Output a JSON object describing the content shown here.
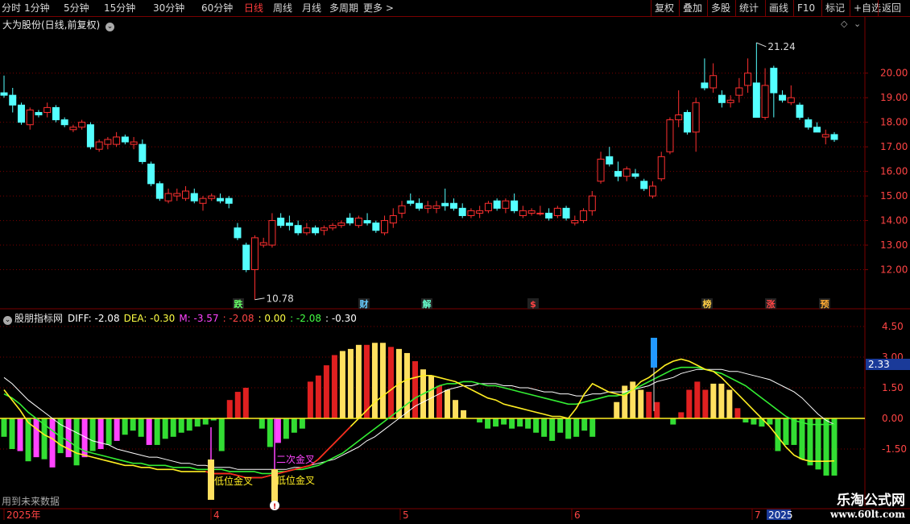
{
  "toolbar": {
    "left": [
      "分时",
      "1分钟",
      "5分钟",
      "15分钟",
      "30分钟",
      "60分钟",
      "日线",
      "周线",
      "月线",
      "多周期",
      "更多 >"
    ],
    "active": "日线",
    "right": [
      "复权",
      "叠加",
      "多股",
      "统计",
      "画线",
      "F10",
      "标记",
      "+自选",
      "返回"
    ]
  },
  "main_title": "大为股份(日线,前复权)",
  "price_axis": {
    "labels": [
      "20.00",
      "19.00",
      "18.00",
      "17.00",
      "16.00",
      "15.00",
      "14.00",
      "13.00",
      "12.00"
    ]
  },
  "annotations": {
    "high": "21.24",
    "low": "10.78"
  },
  "events": [
    {
      "label": "跌",
      "color": "#66ff66"
    },
    {
      "label": "财",
      "color": "#66ccff"
    },
    {
      "label": "解",
      "color": "#66ffcc"
    },
    {
      "label": "$",
      "color": "#ff4444"
    },
    {
      "label": "榜",
      "color": "#ffcc44"
    },
    {
      "label": "涨",
      "color": "#ff4444"
    },
    {
      "label": "预",
      "color": "#ffaa33"
    }
  ],
  "indicator": {
    "name": "股朋指标网",
    "items": [
      {
        "label": "DIFF: -2.08",
        "color": "#ffffff"
      },
      {
        "label": "DEA: -0.30",
        "color": "#ffff44"
      },
      {
        "label": "M: -3.57",
        "color": "#ff44ff"
      },
      {
        "label": ": -2.08",
        "color": "#ff4444"
      },
      {
        "label": ": 0.00",
        "color": "#ffff44"
      },
      {
        "label": ": -2.08",
        "color": "#44ff44"
      },
      {
        "label": ": -0.30",
        "color": "#ffffff"
      }
    ],
    "axis_labels": [
      "4.50",
      "3.00",
      "1.50",
      "0.00",
      "-1.50"
    ],
    "current_value": "2.33",
    "labels": {
      "cross1": "低位金叉",
      "cross2": "低位金叉",
      "cross3": "二次金叉"
    }
  },
  "footer_note": "用到未来数据",
  "date_axis": {
    "labels": [
      "2025年",
      "4",
      "5",
      "6",
      "7"
    ],
    "current": "2025"
  },
  "watermark": {
    "line1": "乐淘公式网",
    "line2": "www.60lt.com"
  },
  "colors": {
    "up": "#ff3030",
    "down": "#54ffff",
    "grid": "#7a0000",
    "axis_text": "#ff4444"
  },
  "chart_data": {
    "type": "candlestick",
    "candles": [
      [
        19.2,
        19.9,
        19.0,
        19.1
      ],
      [
        19.1,
        19.4,
        18.4,
        18.7
      ],
      [
        18.7,
        18.8,
        17.9,
        18.0
      ],
      [
        17.9,
        18.6,
        17.7,
        18.5
      ],
      [
        18.4,
        18.5,
        18.2,
        18.3
      ],
      [
        18.4,
        18.8,
        18.2,
        18.6
      ],
      [
        18.6,
        18.7,
        18.0,
        18.1
      ],
      [
        18.1,
        18.2,
        17.8,
        17.9
      ],
      [
        17.7,
        17.9,
        17.6,
        17.8
      ],
      [
        17.8,
        18.1,
        17.7,
        18.0
      ],
      [
        17.9,
        18.0,
        16.9,
        17.0
      ],
      [
        16.9,
        17.3,
        16.8,
        17.2
      ],
      [
        17.1,
        17.4,
        16.9,
        17.3
      ],
      [
        17.1,
        17.6,
        17.0,
        17.4
      ],
      [
        17.4,
        17.5,
        17.1,
        17.2
      ],
      [
        17.1,
        17.4,
        16.9,
        17.2
      ],
      [
        17.1,
        17.3,
        16.3,
        16.4
      ],
      [
        16.3,
        16.4,
        15.4,
        15.5
      ],
      [
        15.5,
        15.6,
        14.8,
        14.9
      ],
      [
        14.8,
        15.3,
        14.7,
        15.1
      ],
      [
        15.0,
        15.3,
        14.8,
        15.1
      ],
      [
        14.9,
        15.4,
        14.8,
        15.2
      ],
      [
        15.1,
        15.3,
        14.7,
        14.8
      ],
      [
        14.7,
        15.0,
        14.4,
        14.9
      ],
      [
        14.9,
        15.1,
        14.8,
        15.0
      ],
      [
        14.9,
        15.1,
        14.7,
        14.8
      ],
      [
        14.9,
        15.0,
        14.5,
        14.7
      ],
      [
        13.7,
        13.9,
        13.2,
        13.3
      ],
      [
        13.0,
        13.1,
        11.9,
        12.0
      ],
      [
        12.0,
        13.4,
        10.78,
        13.3
      ],
      [
        13.0,
        13.3,
        12.9,
        13.1
      ],
      [
        13.0,
        14.3,
        12.9,
        14.0
      ],
      [
        14.1,
        14.3,
        13.7,
        13.8
      ],
      [
        13.9,
        14.2,
        13.6,
        13.8
      ],
      [
        13.8,
        14.0,
        13.4,
        13.5
      ],
      [
        13.5,
        13.9,
        13.4,
        13.7
      ],
      [
        13.7,
        13.8,
        13.4,
        13.5
      ],
      [
        13.6,
        13.8,
        13.4,
        13.7
      ],
      [
        13.7,
        13.9,
        13.6,
        13.8
      ],
      [
        13.8,
        14.0,
        13.7,
        13.9
      ],
      [
        14.1,
        14.3,
        13.8,
        13.9
      ],
      [
        13.8,
        14.2,
        13.7,
        14.1
      ],
      [
        14.0,
        14.3,
        13.8,
        13.9
      ],
      [
        13.9,
        14.0,
        13.5,
        13.6
      ],
      [
        13.5,
        14.2,
        13.4,
        14.0
      ],
      [
        13.9,
        14.5,
        13.7,
        14.2
      ],
      [
        14.3,
        14.8,
        14.1,
        14.6
      ],
      [
        14.8,
        15.1,
        14.6,
        14.7
      ],
      [
        14.7,
        14.9,
        14.4,
        14.5
      ],
      [
        14.5,
        14.8,
        14.3,
        14.6
      ],
      [
        14.5,
        14.8,
        14.3,
        14.6
      ],
      [
        14.7,
        15.3,
        14.4,
        14.6
      ],
      [
        14.7,
        14.9,
        14.4,
        14.5
      ],
      [
        14.5,
        14.7,
        14.1,
        14.2
      ],
      [
        14.2,
        14.5,
        14.1,
        14.4
      ],
      [
        14.3,
        14.6,
        14.1,
        14.4
      ],
      [
        14.4,
        14.8,
        14.3,
        14.7
      ],
      [
        14.8,
        14.9,
        14.4,
        14.5
      ],
      [
        14.5,
        14.9,
        14.3,
        14.8
      ],
      [
        14.8,
        15.1,
        14.3,
        14.4
      ],
      [
        14.2,
        14.6,
        14.1,
        14.4
      ],
      [
        14.3,
        14.5,
        14.2,
        14.4
      ],
      [
        14.3,
        14.6,
        14.2,
        14.3
      ],
      [
        14.3,
        14.5,
        14.0,
        14.1
      ],
      [
        14.2,
        14.6,
        14.1,
        14.5
      ],
      [
        14.5,
        14.6,
        14.0,
        14.1
      ],
      [
        13.9,
        14.2,
        13.8,
        14.0
      ],
      [
        14.0,
        14.5,
        13.9,
        14.4
      ],
      [
        14.4,
        15.2,
        14.2,
        15.0
      ],
      [
        15.6,
        16.8,
        15.5,
        16.5
      ],
      [
        16.6,
        17.0,
        16.2,
        16.3
      ],
      [
        16.0,
        16.4,
        15.6,
        15.8
      ],
      [
        15.8,
        16.2,
        15.6,
        16.1
      ],
      [
        15.9,
        16.1,
        15.7,
        15.8
      ],
      [
        15.6,
        15.7,
        15.2,
        15.3
      ],
      [
        15.0,
        15.6,
        14.9,
        15.4
      ],
      [
        15.7,
        16.8,
        15.6,
        16.6
      ],
      [
        16.8,
        18.2,
        16.7,
        18.1
      ],
      [
        18.1,
        19.3,
        17.8,
        18.3
      ],
      [
        18.4,
        18.5,
        17.5,
        17.6
      ],
      [
        17.6,
        19.0,
        16.8,
        18.8
      ],
      [
        19.6,
        20.6,
        19.3,
        19.4
      ],
      [
        19.4,
        20.4,
        19.2,
        19.9
      ],
      [
        19.1,
        19.3,
        18.6,
        18.8
      ],
      [
        18.8,
        19.1,
        18.6,
        18.9
      ],
      [
        19.1,
        19.8,
        18.8,
        19.4
      ],
      [
        19.5,
        20.6,
        19.2,
        20.0
      ],
      [
        19.6,
        21.24,
        19.5,
        18.2
      ],
      [
        18.2,
        20.2,
        18.1,
        19.5
      ],
      [
        20.2,
        20.3,
        18.2,
        19.2
      ],
      [
        19.1,
        19.3,
        18.8,
        18.9
      ],
      [
        18.8,
        19.5,
        18.7,
        19.0
      ],
      [
        18.7,
        18.8,
        18.1,
        18.2
      ],
      [
        18.1,
        18.2,
        17.7,
        17.8
      ],
      [
        17.8,
        18.0,
        17.6,
        17.6
      ],
      [
        17.4,
        17.7,
        17.1,
        17.5
      ],
      [
        17.5,
        17.6,
        17.2,
        17.3
      ]
    ],
    "dates": {
      "start_label": "2025年",
      "month_labels": [
        "4",
        "5",
        "6",
        "7"
      ]
    },
    "ylim": [
      11.0,
      21.5
    ],
    "indicator": {
      "type": "bar+line",
      "ylim": [
        -2.6,
        5.3
      ],
      "hist": [
        -0.9,
        -1.5,
        -1.6,
        -2.1,
        -1.9,
        -2.0,
        -2.4,
        -1.7,
        -1.9,
        -2.3,
        -1.9,
        -1.6,
        -1.5,
        -1.3,
        -1.1,
        -0.8,
        -0.6,
        -0.9,
        -1.3,
        -1.3,
        -1.0,
        -0.9,
        -0.7,
        -0.6,
        -0.4,
        -0.3,
        -0.1,
        -1.6,
        0.9,
        1.3,
        1.5,
        0,
        -0.5,
        -1.4,
        -1.2,
        -1.0,
        -0.7,
        -0.5,
        1.8,
        2.1,
        2.6,
        3.1,
        3.3,
        3.4,
        3.6,
        3.6,
        3.7,
        3.7,
        3.5,
        3.4,
        3.2,
        2.8,
        2.4,
        2.1,
        1.6,
        1.4,
        0.9,
        0.4,
        0,
        -0.2,
        -0.5,
        -0.4,
        -0.3,
        -0.5,
        -0.4,
        -0.5,
        -0.7,
        -0.9,
        -1.1,
        -0.7,
        -1.0,
        -0.9,
        -0.6,
        -0.9,
        0,
        0,
        0.8,
        1.6,
        1.8,
        1.4,
        1.3,
        0.8,
        0,
        -0.3,
        0.3,
        1.4,
        1.8,
        1.4,
        1.7,
        1.7,
        1.4,
        0.5,
        -0.2,
        -0.3,
        -0.4,
        -0.3,
        -1.6,
        -1.3,
        -1.3,
        -2.0,
        -2.3,
        -2.5,
        -2.8,
        -2.8
      ],
      "diff": [
        1.4,
        0.9,
        0.4,
        -0.2,
        -0.5,
        -0.8,
        -1.0,
        -1.3,
        -1.5,
        -1.7,
        -1.8,
        -1.9,
        -2.0,
        -2.1,
        -2.2,
        -2.3,
        -2.3,
        -2.4,
        -2.4,
        -2.5,
        -2.5,
        -2.5,
        -2.6,
        -2.6,
        -2.6,
        -2.6,
        -2.7,
        -2.7,
        -2.7,
        -2.8,
        -2.9,
        -2.9,
        -2.9,
        -2.8,
        -2.7,
        -2.6,
        -2.5,
        -2.4,
        -2.3,
        -2.0,
        -1.6,
        -1.2,
        -0.8,
        -0.4,
        0.0,
        0.4,
        0.8,
        1.1,
        1.4,
        1.7,
        1.9,
        2.0,
        2.1,
        2.1,
        2.0,
        1.9,
        1.8,
        1.6,
        1.4,
        1.2,
        1.0,
        0.9,
        0.7,
        0.6,
        0.5,
        0.4,
        0.3,
        0.2,
        0.1,
        0.1,
        0.0,
        0.5,
        1.2,
        1.7,
        1.5,
        1.3,
        1.2,
        1.1,
        1.4,
        1.8,
        2.0,
        2.3,
        2.6,
        2.8,
        2.9,
        2.8,
        2.6,
        2.4,
        2.3,
        2.0,
        1.6,
        1.2,
        0.8,
        0.4,
        0.0,
        -0.4,
        -0.9,
        -1.4,
        -1.8,
        -2.0,
        -2.1,
        -2.1,
        -2.1,
        -2.08
      ],
      "dea": [
        1.2,
        1.0,
        0.7,
        0.3,
        0.0,
        -0.3,
        -0.6,
        -0.9,
        -1.1,
        -1.4,
        -1.6,
        -1.7,
        -1.8,
        -1.9,
        -2.0,
        -2.1,
        -2.2,
        -2.2,
        -2.3,
        -2.3,
        -2.3,
        -2.4,
        -2.4,
        -2.4,
        -2.5,
        -2.5,
        -2.5,
        -2.5,
        -2.6,
        -2.6,
        -2.6,
        -2.6,
        -2.7,
        -2.7,
        -2.6,
        -2.6,
        -2.5,
        -2.5,
        -2.4,
        -2.3,
        -2.1,
        -1.9,
        -1.7,
        -1.4,
        -1.1,
        -0.8,
        -0.5,
        -0.2,
        0.1,
        0.4,
        0.7,
        1.0,
        1.2,
        1.4,
        1.6,
        1.7,
        1.7,
        1.8,
        1.8,
        1.7,
        1.6,
        1.6,
        1.5,
        1.4,
        1.3,
        1.2,
        1.1,
        1.0,
        0.9,
        0.8,
        0.7,
        0.7,
        0.8,
        0.9,
        1.0,
        1.1,
        1.1,
        1.2,
        1.4,
        1.6,
        1.8,
        2.0,
        2.2,
        2.4,
        2.5,
        2.5,
        2.5,
        2.4,
        2.3,
        2.2,
        2.0,
        1.8,
        1.6,
        1.3,
        1.0,
        0.7,
        0.4,
        0.1,
        -0.1,
        -0.2,
        -0.3,
        -0.3,
        -0.3,
        -0.3
      ],
      "slow": [
        2.0,
        1.7,
        1.3,
        0.9,
        0.6,
        0.3,
        0.0,
        -0.3,
        -0.5,
        -0.7,
        -0.9,
        -1.1,
        -1.2,
        -1.3,
        -1.5,
        -1.6,
        -1.7,
        -1.8,
        -1.9,
        -1.9,
        -2.0,
        -2.1,
        -2.2,
        -2.2,
        -2.3,
        -2.3,
        -2.4,
        -2.4,
        -2.4,
        -2.5,
        -2.5,
        -2.5,
        -2.5,
        -2.5,
        -2.5,
        -2.5,
        -2.4,
        -2.4,
        -2.3,
        -2.2,
        -2.1,
        -2.0,
        -1.8,
        -1.6,
        -1.4,
        -1.1,
        -0.9,
        -0.6,
        -0.3,
        0.0,
        0.3,
        0.6,
        0.8,
        1.0,
        1.2,
        1.4,
        1.5,
        1.6,
        1.6,
        1.7,
        1.7,
        1.7,
        1.6,
        1.6,
        1.5,
        1.5,
        1.4,
        1.3,
        1.3,
        1.2,
        1.2,
        1.1,
        1.1,
        1.2,
        1.2,
        1.3,
        1.3,
        1.3,
        1.4,
        1.5,
        1.6,
        1.8,
        1.9,
        2.0,
        2.2,
        2.3,
        2.4,
        2.4,
        2.4,
        2.4,
        2.3,
        2.3,
        2.2,
        2.1,
        2.0,
        1.9,
        1.7,
        1.5,
        1.3,
        1.0,
        0.6,
        0.2,
        -0.1,
        -0.3
      ]
    }
  }
}
